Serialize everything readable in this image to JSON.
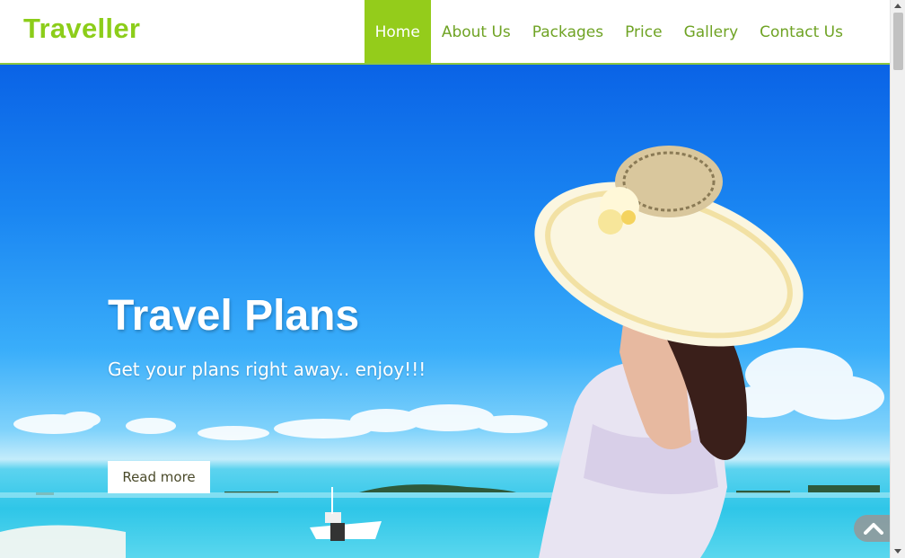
{
  "header": {
    "logo": "Traveller",
    "nav": [
      {
        "label": "Home",
        "active": true
      },
      {
        "label": "About Us",
        "active": false
      },
      {
        "label": "Packages",
        "active": false
      },
      {
        "label": "Price",
        "active": false
      },
      {
        "label": "Gallery",
        "active": false
      },
      {
        "label": "Contact Us",
        "active": false
      }
    ]
  },
  "hero": {
    "title": "Travel Plans",
    "subtitle": "Get your plans right away.. enjoy!!!",
    "button": "Read more"
  },
  "colors": {
    "brand": "#8ccd1a",
    "nav_active_bg": "#94cc1b",
    "nav_text": "#6fa324"
  },
  "icons": {
    "scroll_top": "chevron-up-icon"
  }
}
